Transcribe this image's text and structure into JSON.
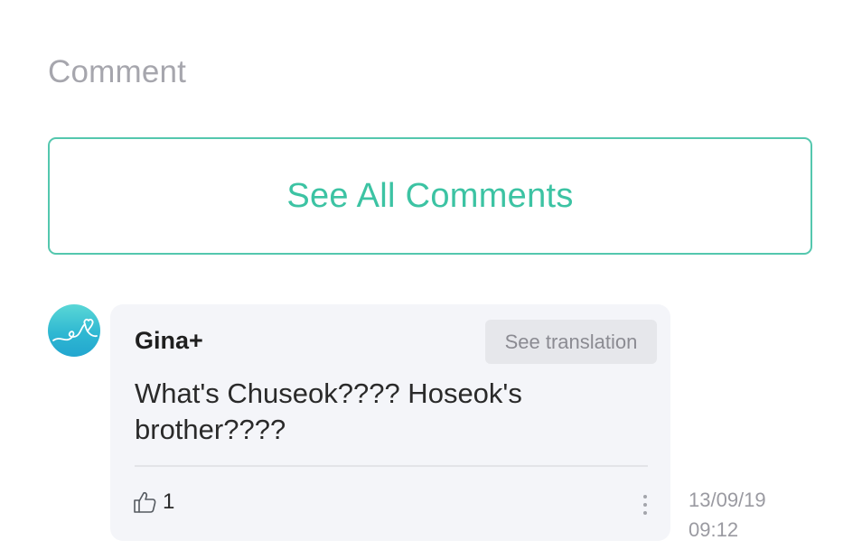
{
  "section": {
    "title": "Comment"
  },
  "see_all": {
    "label": "See All Comments"
  },
  "comment": {
    "author": "Gina+",
    "translate_label": "See translation",
    "text": "What's Chuseok???? Hoseok's brother????",
    "likes": "1",
    "date": "13/09/19",
    "time": "09:12"
  },
  "colors": {
    "accent": "#3cc3a3",
    "bubble_bg": "#f4f5f9",
    "muted_text": "#a6a6ad"
  },
  "icons": {
    "avatar": "heart-doodle-avatar",
    "like": "thumbs-up-icon",
    "more": "more-vertical-icon"
  }
}
